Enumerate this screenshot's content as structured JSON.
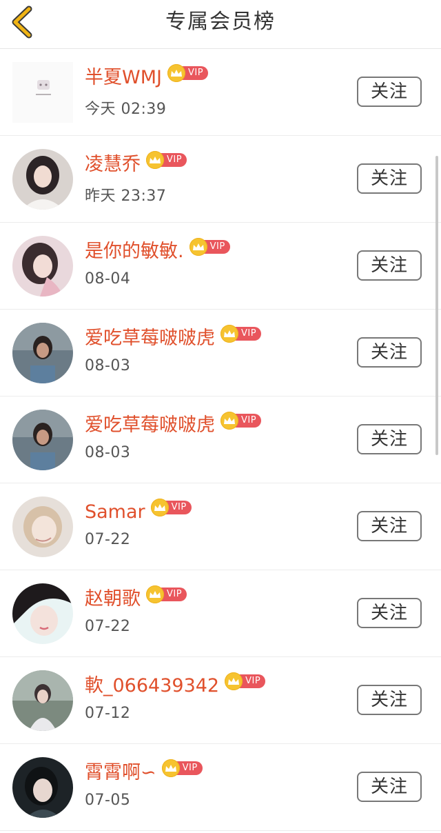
{
  "header": {
    "title": "专属会员榜",
    "back_icon": "chevron-left-icon",
    "back_color": "#f0b415"
  },
  "vip_label": "VIP",
  "follow_label": "关注",
  "colors": {
    "name": "#e0502c",
    "vip_tag": "#e9565c",
    "crown": "#f6c330"
  },
  "members": [
    {
      "name": "半夏WMJ",
      "time": "今天 02:39",
      "avatar": "logo-avatar"
    },
    {
      "name": "凌慧乔",
      "time": "昨天 23:37",
      "avatar": "photo-avatar"
    },
    {
      "name": "是你的敏敏.",
      "time": "08-04",
      "avatar": "photo-avatar"
    },
    {
      "name": "爱吃草莓啵啵虎",
      "time": "08-03",
      "avatar": "photo-avatar"
    },
    {
      "name": "爱吃草莓啵啵虎",
      "time": "08-03",
      "avatar": "photo-avatar"
    },
    {
      "name": "Samar",
      "time": "07-22",
      "avatar": "photo-avatar"
    },
    {
      "name": "赵朝歌",
      "time": "07-22",
      "avatar": "photo-avatar"
    },
    {
      "name": "軟_066439342",
      "time": "07-12",
      "avatar": "photo-avatar"
    },
    {
      "name": "霄霄啊∽",
      "time": "07-05",
      "avatar": "photo-avatar"
    }
  ]
}
